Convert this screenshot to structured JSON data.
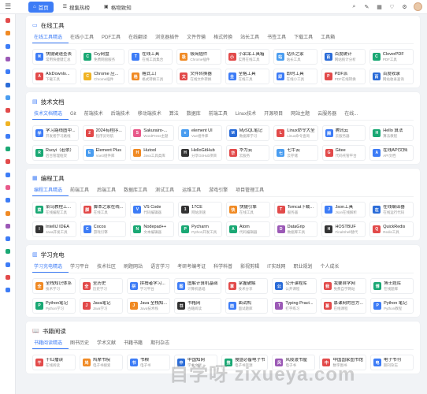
{
  "header": {
    "menu_icon": "menu-icon",
    "tabs": [
      {
        "label": "首页",
        "icon": "home-icon",
        "active": true
      },
      {
        "label": "搜集热榜",
        "icon": "hot-list-icon",
        "active": false
      },
      {
        "label": "格物致知",
        "icon": "book-icon",
        "active": false
      }
    ],
    "tools": [
      "search-icon",
      "edit-icon",
      "grid-icon",
      "heart-icon",
      "settings-icon"
    ]
  },
  "rail_colors": [
    "#e24a4a",
    "#f08a24",
    "#3d7cf6",
    "#9b59b6",
    "#3d7cf6",
    "#2b6cd8",
    "#4a9df0",
    "#e24a4a",
    "#f0b323",
    "#3d7cf6",
    "#1aa874",
    "#e24a4a",
    "#3d7cf6",
    "#e85a8a",
    "#3d7cf6",
    "#f08a24",
    "#9b59b6",
    "#3d7cf6",
    "#1aa874",
    "#3d7cf6",
    "#e24a4a",
    "#3d7cf6"
  ],
  "sections": [
    {
      "title": "在线工具",
      "icon": "toolbox-icon",
      "tabs": [
        "在线工具精选",
        "在线小工具",
        "PDF工具",
        "在线翻译",
        "浏览器插件",
        "文件传输",
        "格式转换",
        "站长工具",
        "书签工具",
        "下载工具",
        "工具箱"
      ],
      "tiles": [
        {
          "name": "快捷键速查表",
          "desc": "常用快捷键汇总",
          "color": "#3d7cf6",
          "glyph": "⌘"
        },
        {
          "name": "Cry网盘",
          "desc": "免费网盘服务",
          "color": "#1aa874",
          "glyph": "C"
        },
        {
          "name": "在线工具",
          "desc": "在线工具集合",
          "color": "#3d7cf6",
          "glyph": "T"
        },
        {
          "name": "极简插件",
          "desc": "Chrome插件",
          "color": "#f08a24",
          "glyph": "极"
        },
        {
          "name": "小呆呆工具箱",
          "desc": "实用在线工具",
          "color": "#e24a4a",
          "glyph": "小"
        },
        {
          "name": "站长之家",
          "desc": "站长工具",
          "color": "#4a9df0",
          "glyph": "站"
        },
        {
          "name": "百度统计",
          "desc": "网站统计分析",
          "color": "#2b6cd8",
          "glyph": "百"
        },
        {
          "name": "CloverPDF",
          "desc": "PDF工具",
          "color": "#1aa874",
          "glyph": "C"
        },
        {
          "name": "AlxDownlo...",
          "desc": "下载工具",
          "color": "#e24a4a",
          "glyph": "A"
        },
        {
          "name": "Chrome 应...",
          "desc": "Chrome插件",
          "color": "#f0b323",
          "glyph": "C"
        },
        {
          "name": "格式工厂",
          "desc": "格式转换工具",
          "color": "#f08a24",
          "glyph": "格"
        },
        {
          "name": "文件转换器",
          "desc": "在线文件转换",
          "color": "#e24a4a",
          "glyph": "文"
        },
        {
          "name": "全格工具",
          "desc": "在线工具",
          "color": "#3d7cf6",
          "glyph": "全"
        },
        {
          "name": "即时工具",
          "desc": "在线小工具",
          "color": "#3d7cf6",
          "glyph": "即"
        },
        {
          "name": "PDF派",
          "desc": "PDF在线转换",
          "color": "#e24a4a",
          "glyph": "P"
        },
        {
          "name": "百度收录",
          "desc": "网站收录查询",
          "color": "#2b6cd8",
          "glyph": "百"
        }
      ]
    },
    {
      "title": "技术文档",
      "icon": "doc-icon",
      "tabs": [
        "技术文档精选",
        "Git",
        "前端技术",
        "后端技术",
        "移动端技术",
        "算法",
        "数据库",
        "前端工具",
        "Linux技术",
        "开源项目",
        "网站主题",
        "云服务器",
        "在线..."
      ],
      "tiles": [
        {
          "name": "学习路线图中...",
          "desc": "开发者学习路线",
          "color": "#3d7cf6",
          "glyph": "学"
        },
        {
          "name": "2024有程序...",
          "desc": "程序员导航",
          "color": "#e24a4a",
          "glyph": "2"
        },
        {
          "name": "Sakurairo-...",
          "desc": "WordPress主题",
          "color": "#e85a8a",
          "glyph": "S"
        },
        {
          "name": "element UI",
          "desc": "Vue组件库",
          "color": "#4a9df0",
          "glyph": "e"
        },
        {
          "name": "MySQL笔记",
          "desc": "数据库学习",
          "color": "#2b6cd8",
          "glyph": "M"
        },
        {
          "name": "Linux命令大全",
          "desc": "Linux命令查询",
          "color": "#e24a4a",
          "glyph": "L"
        },
        {
          "name": "腾讯云",
          "desc": "云服务器",
          "color": "#3d7cf6",
          "glyph": "腾"
        },
        {
          "name": "Hello 算法",
          "desc": "算法教程",
          "color": "#1aa874",
          "glyph": "H"
        },
        {
          "name": "Ruoyi（若依）",
          "desc": "后台管理框架",
          "color": "#1aa874",
          "glyph": "R"
        },
        {
          "name": "Element Plus",
          "desc": "Vue3组件库",
          "color": "#4a9df0",
          "glyph": "E"
        },
        {
          "name": "Hutool",
          "desc": "Java工具类库",
          "color": "#f08a24",
          "glyph": "H"
        },
        {
          "name": "HelloGitHub",
          "desc": "分享GitHub项目",
          "color": "#333333",
          "glyph": "H"
        },
        {
          "name": "华为云",
          "desc": "云服务",
          "color": "#e24a4a",
          "glyph": "华"
        },
        {
          "name": "七牛云",
          "desc": "云存储",
          "color": "#4a9df0",
          "glyph": "七"
        },
        {
          "name": "Gitee",
          "desc": "代码托管平台",
          "color": "#e24a4a",
          "glyph": "G"
        },
        {
          "name": "在线API文档",
          "desc": "API文档",
          "color": "#3d7cf6",
          "glyph": "A"
        }
      ]
    },
    {
      "title": "编程工具",
      "icon": "code-icon",
      "tabs": [
        "编程工具精选",
        "前端工具",
        "后端工具",
        "数据库工具",
        "测试工具",
        "运维工具",
        "游戏引擎",
        "项目管理工具"
      ],
      "tiles": [
        {
          "name": "菜鸟教程工...",
          "desc": "在线编程工具",
          "color": "#1aa874",
          "glyph": "菜"
        },
        {
          "name": "脚本之家在线...",
          "desc": "在线工具",
          "color": "#e24a4a",
          "glyph": "脚"
        },
        {
          "name": "VS Code",
          "desc": "代码编辑器",
          "color": "#3d7cf6",
          "glyph": "V"
        },
        {
          "name": "17CE",
          "desc": "网站测速",
          "color": "#333333",
          "glyph": "1"
        },
        {
          "name": "快捷引擎",
          "desc": "在线工具",
          "color": "#f08a24",
          "glyph": "快"
        },
        {
          "name": "Tomcat下载...",
          "desc": "服务器",
          "color": "#e24a4a",
          "glyph": "T"
        },
        {
          "name": "Json工具",
          "desc": "Json在线解析",
          "color": "#3d7cf6",
          "glyph": "J"
        },
        {
          "name": "在线编译器",
          "desc": "在线运行代码",
          "color": "#2b6cd8",
          "glyph": "在"
        },
        {
          "name": "IntelliJ IDEA",
          "desc": "Java开发工具",
          "color": "#333333",
          "glyph": "I"
        },
        {
          "name": "Cocos",
          "desc": "游戏引擎",
          "color": "#3d7cf6",
          "glyph": "C"
        },
        {
          "name": "Nodepad++",
          "desc": "文本编辑器",
          "color": "#1aa874",
          "glyph": "N"
        },
        {
          "name": "Pycharm",
          "desc": "Python开发工具",
          "color": "#1aa874",
          "glyph": "P"
        },
        {
          "name": "Atom",
          "desc": "代码编辑器",
          "color": "#1aa874",
          "glyph": "A"
        },
        {
          "name": "DataGrip",
          "desc": "数据库工具",
          "color": "#9b59b6",
          "glyph": "D"
        },
        {
          "name": "HOSTBUF",
          "desc": "FinalShell替代",
          "color": "#333333",
          "glyph": "H"
        },
        {
          "name": "QuickRedis",
          "desc": "Redis工具",
          "color": "#e24a4a",
          "glyph": "Q"
        }
      ]
    },
    {
      "title": "学习充电",
      "icon": "learn-icon",
      "tabs": [
        "学习充电精选",
        "学习平台",
        "技术社区",
        "刷题网站",
        "语言学习",
        "考研考编考证",
        "科学科普",
        "影视剪辑",
        "IT实践网",
        "职业规划",
        "个人成长"
      ],
      "tiles": [
        {
          "name": "全栈知识体系",
          "desc": "技术学习",
          "color": "#f08a24",
          "glyph": "全"
        },
        {
          "name": "全历史",
          "desc": "历史学习",
          "color": "#e24a4a",
          "glyph": "全"
        },
        {
          "name": "拼搏者学习...",
          "desc": "学习平台",
          "color": "#3d7cf6",
          "glyph": "拼"
        },
        {
          "name": "图解计算机基础",
          "desc": "计算机基础",
          "color": "#3d7cf6",
          "glyph": "图"
        },
        {
          "name": "掌握破解",
          "desc": "技术分享",
          "color": "#e24a4a",
          "glyph": "掌"
        },
        {
          "name": "公开课程库",
          "desc": "公开课程",
          "color": "#2b6cd8",
          "glyph": "公"
        },
        {
          "name": "我要自学网",
          "desc": "免费自学网站",
          "color": "#e24a4a",
          "glyph": "我"
        },
        {
          "name": "博士题库",
          "desc": "在线题库",
          "color": "#1aa874",
          "glyph": "博"
        },
        {
          "name": "Python笔记",
          "desc": "Python学习",
          "color": "#1aa874",
          "glyph": "P"
        },
        {
          "name": "Java笔记",
          "desc": "Java学习",
          "color": "#e24a4a",
          "glyph": "J"
        },
        {
          "name": "Java 全栈知...",
          "desc": "Java技术栈",
          "color": "#f08a24",
          "glyph": "J"
        },
        {
          "name": "书格网",
          "desc": "古籍阅读",
          "color": "#333333",
          "glyph": "书"
        },
        {
          "name": "面试鸭",
          "desc": "面试题库",
          "color": "#3d7cf6",
          "glyph": "面"
        },
        {
          "name": "Typing Pract...",
          "desc": "打字练习",
          "color": "#9b59b6",
          "glyph": "T"
        },
        {
          "name": "慕课网的官方...",
          "desc": "在线课程",
          "color": "#e24a4a",
          "glyph": "慕"
        },
        {
          "name": "Python 笔记",
          "desc": "Python教程",
          "color": "#3d7cf6",
          "glyph": "P"
        }
      ]
    },
    {
      "title": "书籍阅读",
      "icon": "book-read-icon",
      "tabs": [
        "书籍阅读精选",
        "图书历史",
        "学术文献",
        "书籍书籍",
        "期刊杂志"
      ],
      "tiles": [
        {
          "name": "干红播读",
          "desc": "在线阅读",
          "color": "#e24a4a",
          "glyph": "干"
        },
        {
          "name": "鸠摩书院",
          "desc": "电子书搜索",
          "color": "#f08a24",
          "glyph": "鸠"
        },
        {
          "name": "书粮",
          "desc": "电子书",
          "color": "#3d7cf6",
          "glyph": "书"
        },
        {
          "name": "中国知网",
          "desc": "学术文献",
          "color": "#2b6cd8",
          "glyph": "中"
        },
        {
          "name": "搜盘必备电子书",
          "desc": "电子书资源",
          "color": "#1aa874",
          "glyph": "搜"
        },
        {
          "name": "风陵渡书屋",
          "desc": "电子书",
          "color": "#9b59b6",
          "glyph": "风"
        },
        {
          "name": "中国国家图书馆",
          "desc": "数字图书",
          "color": "#e24a4a",
          "glyph": "中"
        },
        {
          "name": "电子书刊",
          "desc": "期刊杂志",
          "color": "#3d7cf6",
          "glyph": "电"
        }
      ]
    }
  ],
  "watermark": "自学呀 zixueya.com"
}
